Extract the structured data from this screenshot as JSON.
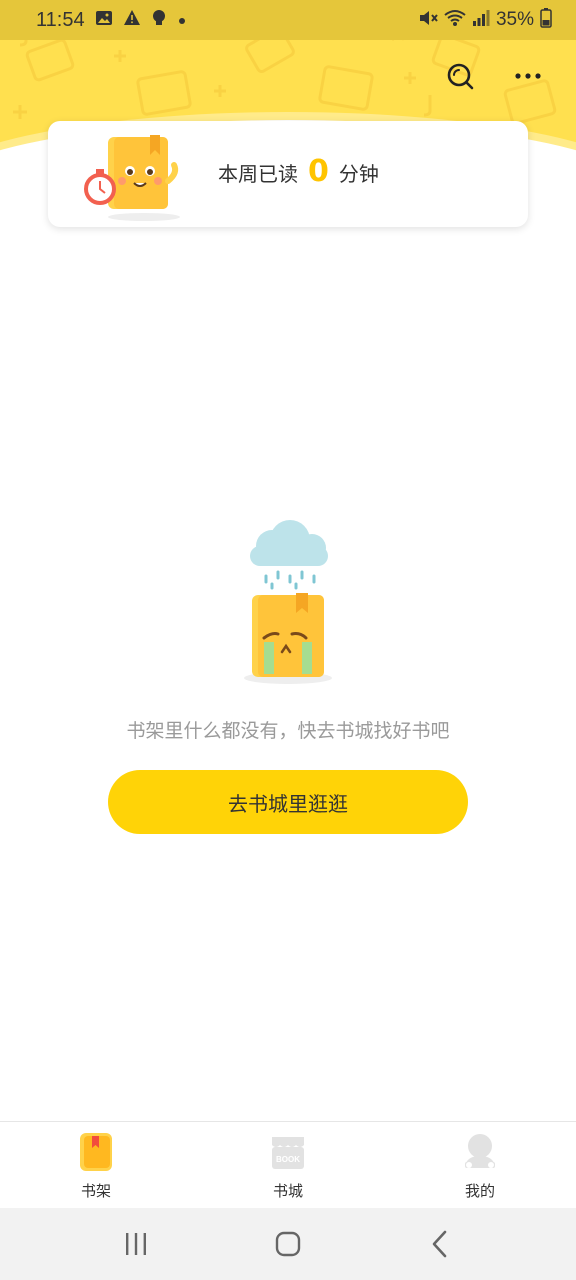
{
  "status_bar": {
    "time": "11:54",
    "battery": "35%",
    "icons": [
      "image-icon",
      "warning-icon",
      "bulb-icon",
      "dot-icon",
      "mute-icon",
      "wifi-icon",
      "signal-icon",
      "battery-icon"
    ]
  },
  "header": {
    "actions": [
      {
        "name": "search-icon"
      },
      {
        "name": "more-icon"
      }
    ]
  },
  "reading_card": {
    "prefix": "本周已读",
    "minutes": "0",
    "suffix": "分钟"
  },
  "empty_state": {
    "message": "书架里什么都没有，快去书城找好书吧",
    "button_label": "去书城里逛逛"
  },
  "bottom_nav": {
    "items": [
      {
        "label": "书架",
        "icon": "bookshelf-icon",
        "active": true
      },
      {
        "label": "书城",
        "icon": "bookstore-icon",
        "active": false
      },
      {
        "label": "我的",
        "icon": "profile-icon",
        "active": false
      }
    ]
  },
  "system_nav": {
    "buttons": [
      "recent-apps-icon",
      "home-icon",
      "back-icon"
    ]
  },
  "colors": {
    "accent": "#ffd307",
    "header": "#ffe04f",
    "status_bar": "#e5c63a",
    "minutes": "#ffc400",
    "muted_text": "#9a9a9a"
  }
}
